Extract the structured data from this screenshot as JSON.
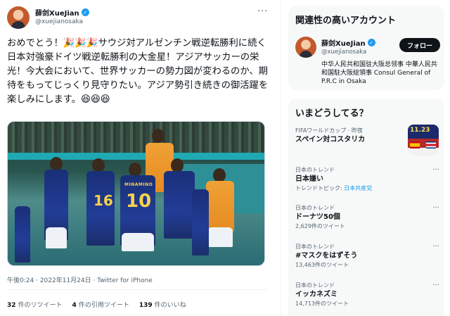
{
  "tweet": {
    "author_name": "薛剑XueJian",
    "author_handle": "@xuejianosaka",
    "more_icon": "more-horizontal-icon",
    "text": "おめでとう！🎉🎉🎉サウジ対アルゼンチン戦逆転勝利に続く日本対強豪ドイツ戦逆転勝利の大金星！アジアサッカーの栄光！今大会において、世界サッカーの勢力図が変わるのか、期待をもってじっくり見守りたい。アジア勢引き続きの御活躍を楽しみにします。😆😆😆",
    "photo_numbers": [
      "16",
      "10"
    ],
    "photo_name": "MINAMINO",
    "timestamp": "午後0:24 · 2022年11月24日 · Twitter for iPhone",
    "retweets_count": "32",
    "retweets_label": "件のリツイート",
    "quotes_count": "4",
    "quotes_label": "件の引用ツイート",
    "likes_count": "139",
    "likes_label": "件のいいね"
  },
  "who_to_follow": {
    "title": "関連性の高いアカウント",
    "name": "薛剑XueJian",
    "handle": "@xuejianosaka",
    "follow_label": "フォロー",
    "bio": "中华人民共和国驻大阪总领事 中華人民共和国駐大阪総領事 Consul General of P.R.C in Osaka"
  },
  "trends": {
    "title": "いまどうしてる？",
    "items": [
      {
        "category": "FIFAワールドカップ · 昨夜",
        "name": "スペイン対コスタリカ",
        "sub": "",
        "thumb_score": "11.23"
      },
      {
        "category": "日本のトレンド",
        "name": "日本嫌い",
        "sub_prefix": "トレンドトピック: ",
        "sub_link": "日本共産党"
      },
      {
        "category": "日本のトレンド",
        "name": "ドーナツ50個",
        "sub": "2,629件のツイート"
      },
      {
        "category": "日本のトレンド",
        "name": "#マスクをはずそう",
        "sub": "13,463件のツイート"
      },
      {
        "category": "日本のトレンド",
        "name": "イッカネズミ",
        "sub": "14,713件のツイート"
      }
    ]
  },
  "colors": {
    "accent": "#1d9bf0",
    "text": "#0f1419",
    "muted": "#536471",
    "panel": "#f7f9f9"
  }
}
